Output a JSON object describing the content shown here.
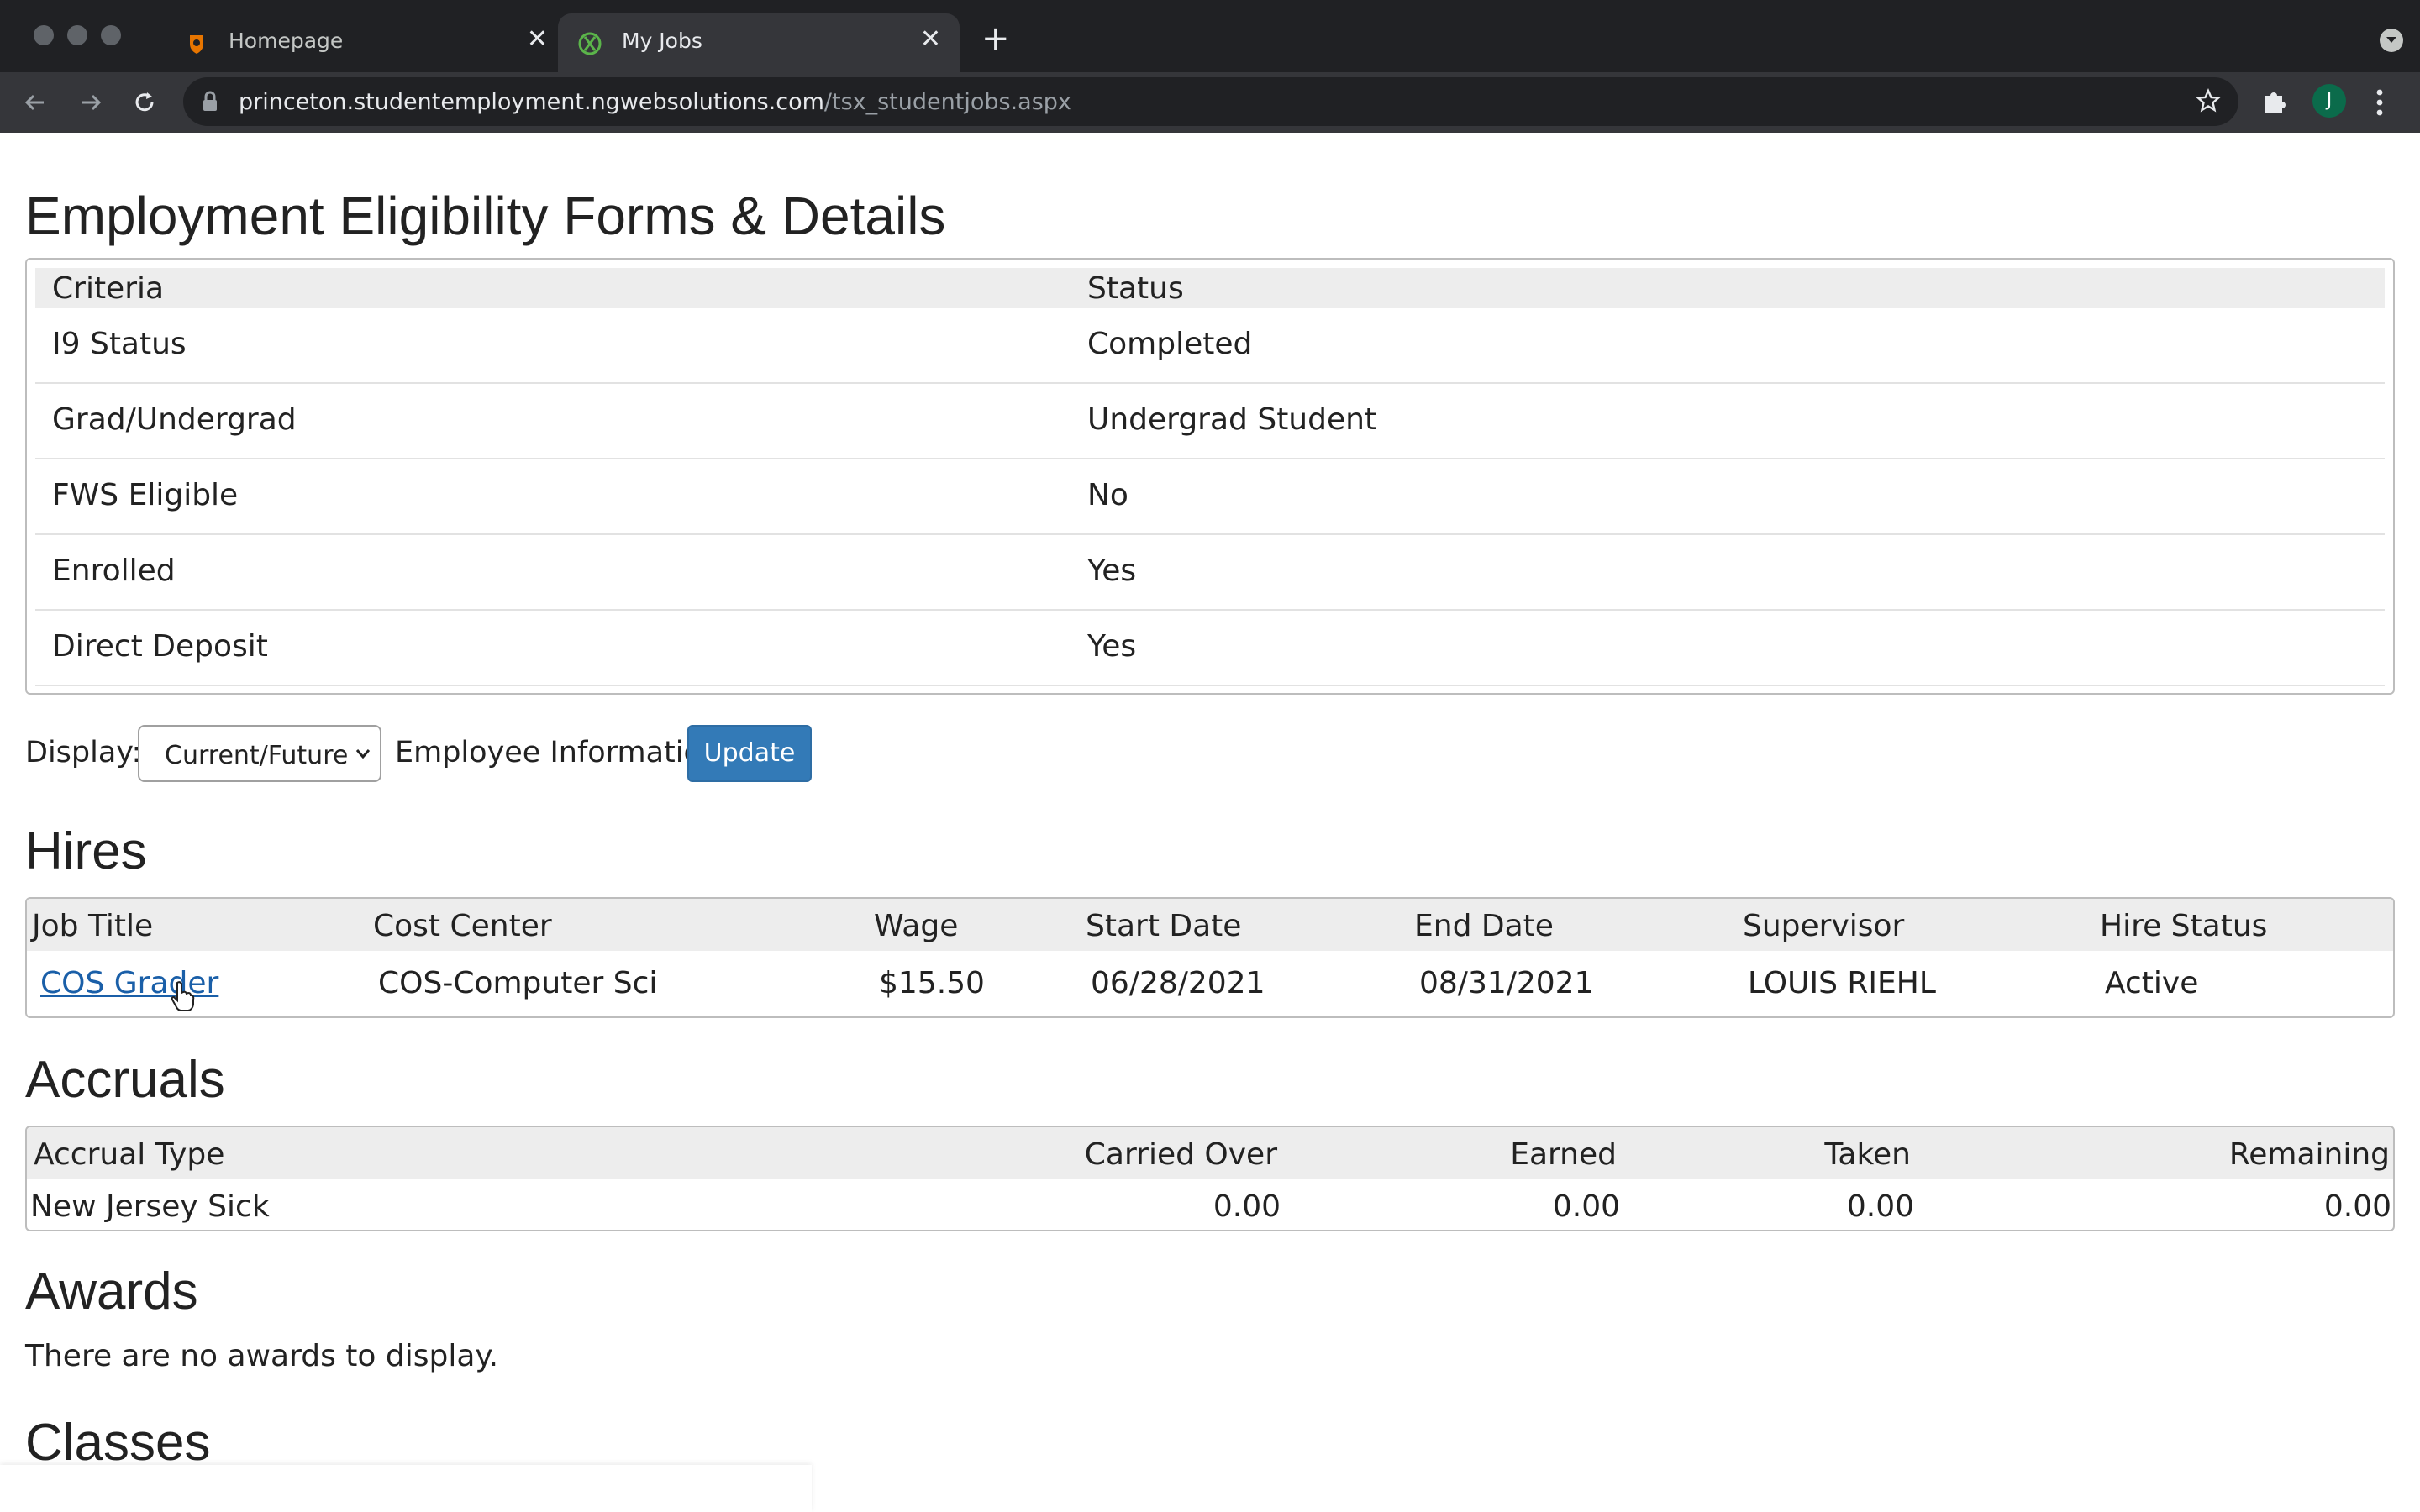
{
  "browser": {
    "tabs": [
      {
        "title": "Homepage",
        "favicon": "princeton-shield-icon",
        "active": false
      },
      {
        "title": "My Jobs",
        "favicon": "ngweb-x-icon",
        "active": true
      }
    ],
    "url_domain": "princeton.studentemployment.ngwebsolutions.com",
    "url_path": "/tsx_studentjobs.aspx",
    "profile_initial": "J",
    "colors": {
      "chrome_dark": "#202124",
      "chrome_toolbar": "#35363a",
      "profile_bg": "#0b6b4b"
    }
  },
  "eligibility": {
    "title": "Employment Eligibility Forms & Details",
    "headers": {
      "criteria": "Criteria",
      "status": "Status"
    },
    "rows": [
      {
        "criteria": "I9 Status",
        "status": "Completed"
      },
      {
        "criteria": "Grad/Undergrad",
        "status": "Undergrad Student"
      },
      {
        "criteria": "FWS Eligible",
        "status": "No"
      },
      {
        "criteria": "Enrolled",
        "status": "Yes"
      },
      {
        "criteria": "Direct Deposit",
        "status": "Yes"
      }
    ]
  },
  "display": {
    "label": "Display:",
    "selected": "Current/Future",
    "employee_info": "Employee Information",
    "update_label": "Update",
    "update_color": "#337ab7"
  },
  "hires": {
    "title": "Hires",
    "headers": [
      "Job Title",
      "Cost Center",
      "Wage",
      "Start Date",
      "End Date",
      "Supervisor",
      "Hire Status"
    ],
    "rows": [
      {
        "job_title": "COS Grader",
        "cost_center": "COS-Computer Sci",
        "wage": "$15.50",
        "start_date": "06/28/2021",
        "end_date": "08/31/2021",
        "supervisor": "LOUIS RIEHL",
        "hire_status": "Active"
      }
    ]
  },
  "accruals": {
    "title": "Accruals",
    "headers": [
      "Accrual Type",
      "Carried Over",
      "Earned",
      "Taken",
      "Remaining"
    ],
    "rows": [
      {
        "type": "New Jersey Sick",
        "carried_over": "0.00",
        "earned": "0.00",
        "taken": "0.00",
        "remaining": "0.00"
      }
    ]
  },
  "awards": {
    "title": "Awards",
    "message": "There are no awards to display."
  },
  "classes": {
    "title": "Classes"
  }
}
